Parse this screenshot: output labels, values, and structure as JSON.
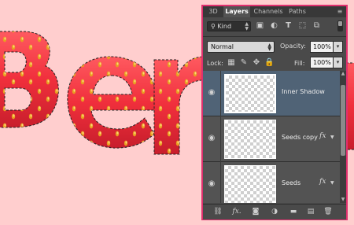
{
  "canvas": {
    "artwork_text": "Berr",
    "background_color": "#ffcece",
    "fill_color": "#f02f3c",
    "seed_color": "#e8a020"
  },
  "panel": {
    "tabs": [
      {
        "label": "3D",
        "active": false
      },
      {
        "label": "Layers",
        "active": true
      },
      {
        "label": "Channels",
        "active": false
      },
      {
        "label": "Paths",
        "active": false
      }
    ],
    "menu_icon": "panel-menu-icon",
    "filter": {
      "kind_label": "Kind",
      "icons": [
        "pixel-filter-icon",
        "adjustment-filter-icon",
        "type-filter-icon",
        "shape-filter-icon",
        "smart-object-filter-icon"
      ]
    },
    "blend_mode": "Normal",
    "opacity_label": "Opacity:",
    "opacity_value": "100%",
    "lock_label": "Lock:",
    "lock_icons": [
      "lock-transparent-icon",
      "lock-paint-icon",
      "lock-position-icon",
      "lock-all-icon"
    ],
    "fill_label": "Fill:",
    "fill_value": "100%",
    "layers": [
      {
        "name": "Inner Shadow",
        "selected": true,
        "has_fx": false,
        "visible": true
      },
      {
        "name": "Seeds copy",
        "selected": false,
        "has_fx": true,
        "visible": true
      },
      {
        "name": "Seeds",
        "selected": false,
        "has_fx": true,
        "visible": true
      }
    ],
    "fx_label": "fx",
    "bottom_icons": [
      "link-layers-icon",
      "add-style-icon",
      "add-mask-icon",
      "adjustment-layer-icon",
      "new-group-icon",
      "new-layer-icon",
      "delete-layer-icon"
    ],
    "accent_border": "#e0306e"
  }
}
